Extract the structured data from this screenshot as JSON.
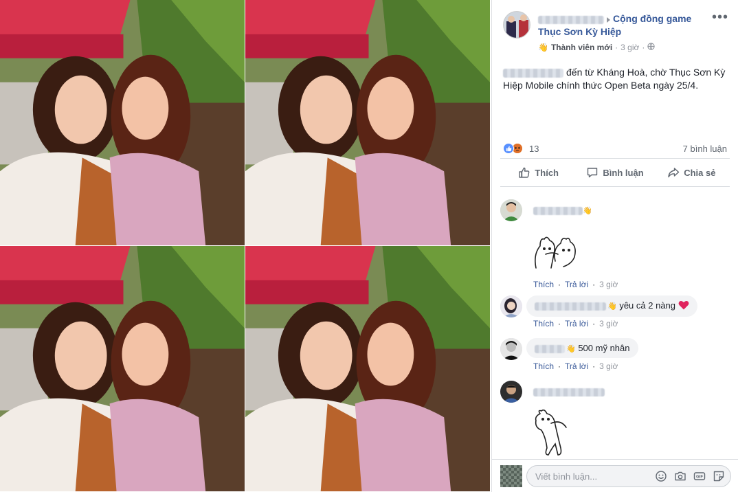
{
  "photo": {
    "tiles": [
      "selfie-top-left",
      "selfie-top-right",
      "selfie-bottom-left",
      "selfie-bottom-right"
    ]
  },
  "post": {
    "group_name": "Cộng đồng game Thục Sơn Kỳ Hiệp",
    "badge": "Thành viên mới",
    "time": "3 giờ",
    "body_text": "đến từ Kháng Hoà, chờ Thục Sơn Kỳ Hiệp Mobile chính thức Open Beta ngày 25/4.",
    "reaction_count": "13",
    "comment_count": "7 bình luận",
    "more_label": "•••"
  },
  "actions": {
    "like": "Thích",
    "comment": "Bình luận",
    "share": "Chia sẻ"
  },
  "comments": [
    {
      "text": "",
      "like": "Thích",
      "reply": "Trả lời",
      "time": "3 giờ"
    },
    {
      "text": "yêu cả 2 nàng",
      "like": "Thích",
      "reply": "Trả lời",
      "time": "3 giờ"
    },
    {
      "text": "500 mỹ nhân",
      "like": "Thích",
      "reply": "Trả lời",
      "time": "3 giờ"
    },
    {
      "text": ""
    }
  ],
  "composer": {
    "placeholder": "Viết bình luận..."
  },
  "colors": {
    "link": "#365899",
    "muted": "#90949c",
    "like_blue": "#5890ff",
    "heart_red": "#e0245e"
  },
  "icons": [
    "wave-icon",
    "globe-icon",
    "like-reaction-icon",
    "angry-reaction-icon",
    "thumb-up-icon",
    "comment-icon",
    "share-icon",
    "heart-icon",
    "emoji-icon",
    "camera-icon",
    "gif-icon",
    "sticker-icon"
  ]
}
